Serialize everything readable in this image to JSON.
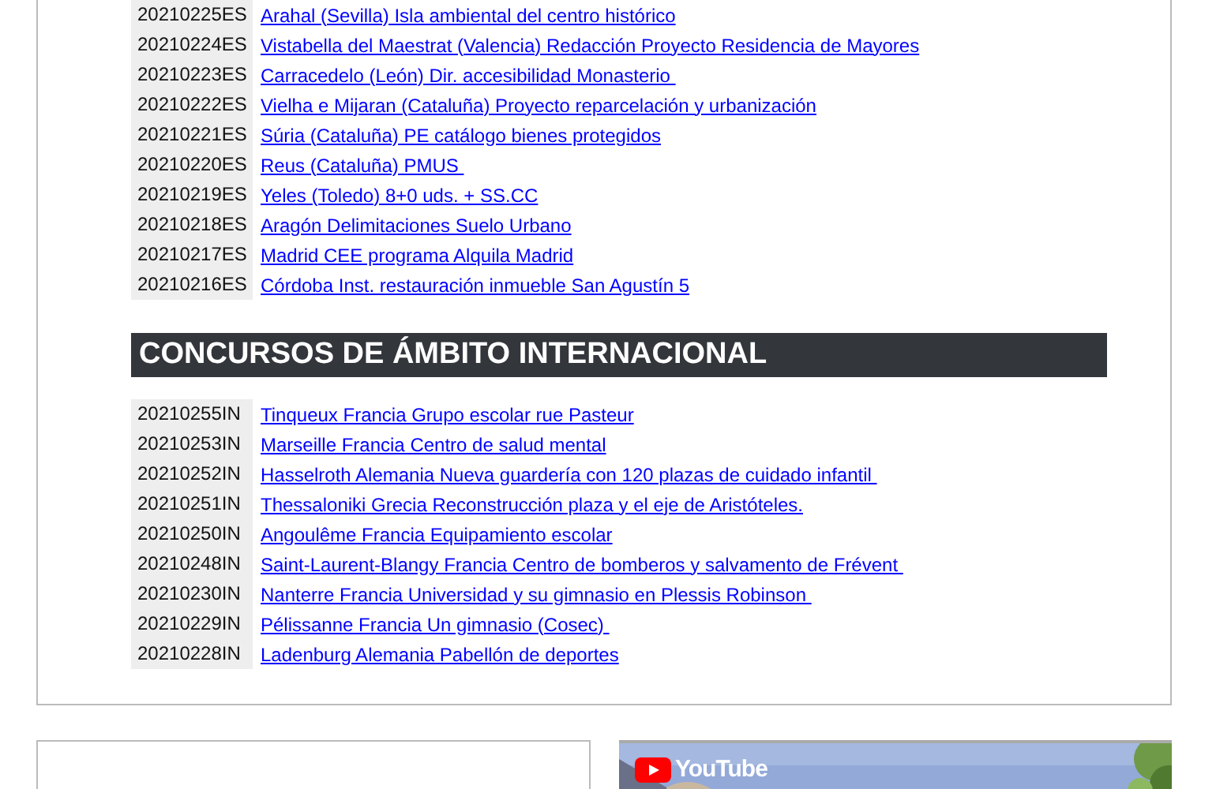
{
  "sections": [
    {
      "rows": [
        {
          "code": "20210225ES",
          "title": "Arahal (Sevilla) Isla ambiental del centro histórico"
        },
        {
          "code": "20210224ES",
          "title": "Vistabella del Maestrat (Valencia) Redacción Proyecto Residencia de Mayores"
        },
        {
          "code": "20210223ES",
          "title": "Carracedelo (León) Dir. accesibilidad Monasterio "
        },
        {
          "code": "20210222ES",
          "title": "Vielha e Mijaran (Cataluña) Proyecto reparcelación y urbanización"
        },
        {
          "code": "20210221ES",
          "title": "Súria (Cataluña) PE catálogo bienes protegidos"
        },
        {
          "code": "20210220ES",
          "title": "Reus (Cataluña) PMUS "
        },
        {
          "code": "20210219ES",
          "title": "Yeles (Toledo) 8+0 uds. + SS.CC"
        },
        {
          "code": "20210218ES",
          "title": "Aragón Delimitaciones Suelo Urbano"
        },
        {
          "code": "20210217ES",
          "title": "Madrid CEE programa Alquila Madrid"
        },
        {
          "code": "20210216ES",
          "title": "Córdoba Inst. restauración inmueble San Agustín 5"
        }
      ]
    },
    {
      "heading": "CONCURSOS DE ÁMBITO INTERNACIONAL",
      "rows": [
        {
          "code": "20210255IN",
          "title": "Tinqueux Francia Grupo escolar rue Pasteur"
        },
        {
          "code": "20210253IN",
          "title": "Marseille Francia Centro de salud mental"
        },
        {
          "code": "20210252IN",
          "title": "Hasselroth Alemania Nueva guardería con 120 plazas de cuidado infantil "
        },
        {
          "code": "20210251IN",
          "title": "Thessaloniki Grecia Reconstrucción plaza y el eje de Aristóteles."
        },
        {
          "code": "20210250IN",
          "title": "Angoulême Francia Equipamiento escolar"
        },
        {
          "code": "20210248IN",
          "title": "Saint-Laurent-Blangy Francia Centro de bomberos y salvamento de Frévent "
        },
        {
          "code": "20210230IN",
          "title": "Nanterre Francia Universidad y su gimnasio en Plessis Robinson "
        },
        {
          "code": "20210229IN",
          "title": "Pélissanne Francia Un gimnasio (Cosec) "
        },
        {
          "code": "20210228IN",
          "title": "Ladenburg Alemania Pabellón de deportes"
        }
      ]
    }
  ],
  "video": {
    "logo": "YouTube"
  }
}
